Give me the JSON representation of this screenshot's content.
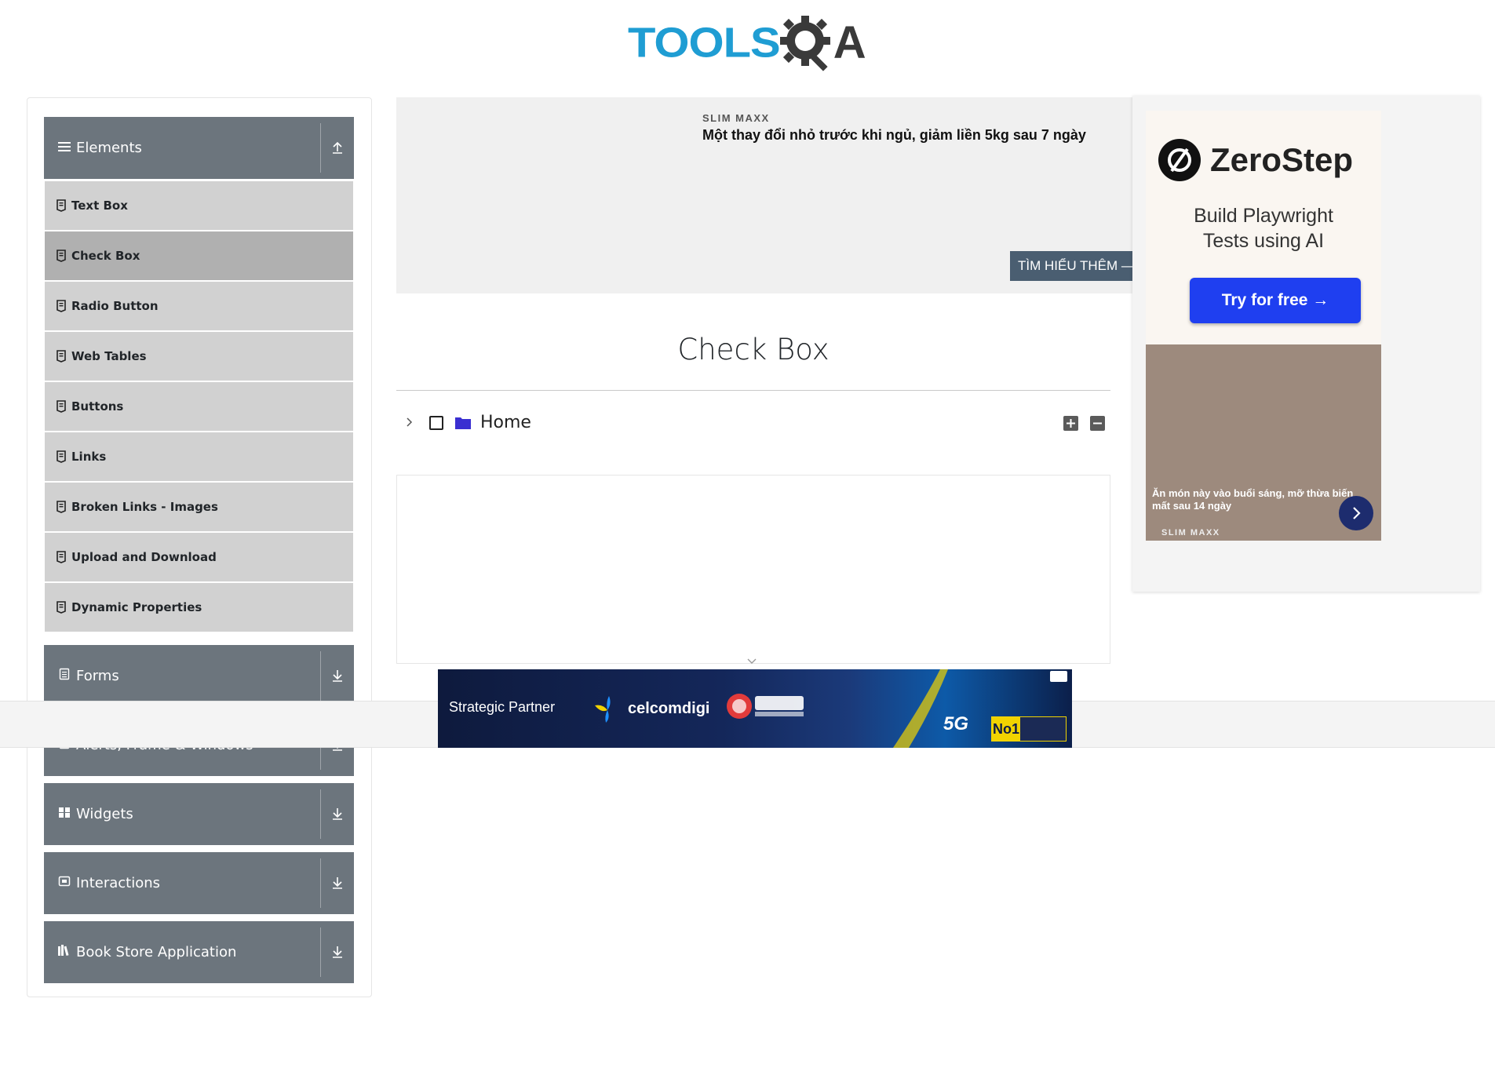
{
  "header": {
    "logo_text": "TOOLS",
    "logo_text_end": "A"
  },
  "sidebar": {
    "groups": [
      {
        "label": "Elements",
        "icon": "menu-icon",
        "expanded": true
      },
      {
        "label": "Forms",
        "icon": "form-icon",
        "expanded": false
      },
      {
        "label": "Alerts, Frame & Windows",
        "icon": "alert-icon",
        "expanded": false
      },
      {
        "label": "Widgets",
        "icon": "widgets-icon",
        "expanded": false
      },
      {
        "label": "Interactions",
        "icon": "interactions-icon",
        "expanded": false
      },
      {
        "label": "Book Store Application",
        "icon": "book-store-icon",
        "expanded": false
      }
    ],
    "items": [
      {
        "label": "Text Box",
        "active": false
      },
      {
        "label": "Check Box",
        "active": true
      },
      {
        "label": "Radio Button",
        "active": false
      },
      {
        "label": "Web Tables",
        "active": false
      },
      {
        "label": "Buttons",
        "active": false
      },
      {
        "label": "Links",
        "active": false
      },
      {
        "label": "Broken Links - Images",
        "active": false
      },
      {
        "label": "Upload and Download",
        "active": false
      },
      {
        "label": "Dynamic Properties",
        "active": false
      }
    ]
  },
  "ad_top": {
    "brand": "SLIM MAXX",
    "headline": "Một thay đổi nhỏ trước khi ngủ, giảm liền 5kg sau 7 ngày",
    "cta": "TÌM HIỂU THÊM —"
  },
  "ad_right": {
    "brand": "ZeroStep",
    "tagline_1": "Build Playwright",
    "tagline_2": "Tests using AI",
    "button": "Try for free →",
    "photo_text": "Ăn món này vào buổi sáng, mỡ thừa biến mất sau 14 ngày",
    "photo_brand": "SLIM MAXX"
  },
  "main": {
    "title": "Check Box",
    "tree_root": {
      "label": "Home",
      "checked": false,
      "expanded": false
    }
  },
  "ad_bottom": {
    "partner_text": "Strategic Partner",
    "partner_brand": "celcomdigi",
    "badge_5g": "5G",
    "badge_no1": "No1"
  },
  "colors": {
    "sidebar_header": "#6c757d",
    "sidebar_item": "#d1d1d1",
    "sidebar_item_active": "#b0b0b0",
    "logo_blue": "#1f9dd3",
    "folder_blue": "#3a2fd1",
    "zerostep_button": "#1f3ff0"
  }
}
